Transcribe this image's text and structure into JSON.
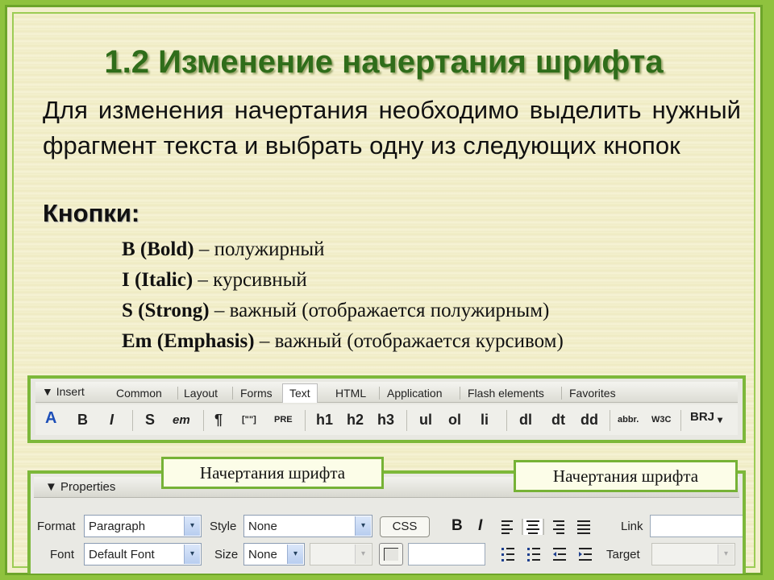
{
  "slide": {
    "title": "1.2 Изменение начертания шрифта",
    "intro": "Для изменения начертания необходимо выделить нужный фрагмент текста и выбрать одну из следующих кнопок",
    "buttons_heading": "Кнопки:",
    "definitions": [
      {
        "term": "B (Bold)",
        "desc": "– полужирный"
      },
      {
        "term": "I (Italic)",
        "desc": "– курсивный"
      },
      {
        "term": "S (Strong)",
        "desc": "– важный (отображается полужирным)"
      },
      {
        "term": "Em (Emphasis)",
        "desc": "– важный (отображается курсивом)"
      }
    ]
  },
  "insert_panel": {
    "label": "▼ Insert",
    "tabs": [
      "Common",
      "Layout",
      "Forms",
      "Text",
      "HTML",
      "Application",
      "Flash elements",
      "Favorites"
    ],
    "active_tab": "Text",
    "icons": [
      "A",
      "B",
      "I",
      "S",
      "em",
      "¶",
      "[\"\"]",
      "PRE",
      "h1",
      "h2",
      "h3",
      "ul",
      "ol",
      "li",
      "dl",
      "dt",
      "dd",
      "abbr.",
      "W3C",
      "BRJ",
      "▾"
    ]
  },
  "properties_panel": {
    "header": "▼ Properties",
    "format_label": "Format",
    "format_value": "Paragraph",
    "style_label": "Style",
    "style_value": "None",
    "css_button": "CSS",
    "link_label": "Link",
    "font_label": "Font",
    "font_value": "Default Font",
    "size_label": "Size",
    "size_value": "None",
    "target_label": "Target",
    "bold_icon": "B",
    "italic_icon": "I",
    "arrow": "▾"
  },
  "callouts": {
    "left": "Начертания шрифта",
    "right": "Начертания шрифта"
  },
  "colors": {
    "frame_green": "#7db83a",
    "title_green": "#2f6d1a",
    "slide_bg": "#f2efcc"
  }
}
